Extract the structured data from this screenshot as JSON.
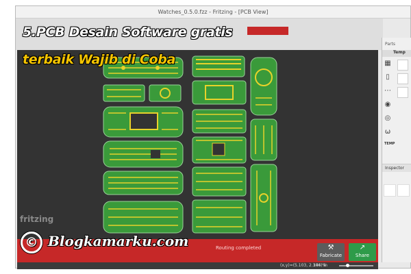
{
  "window": {
    "title": "Watches_0.5.0.fzz - Fritzing - [PCB View]"
  },
  "overlay": {
    "line1": "5.PCB Desain Software gratis",
    "line2": "terbaik Wajib di Coba"
  },
  "canvas": {
    "brand_mark": "fritzing"
  },
  "bottom_bar": {
    "status": "Routing completed",
    "fabricate_label": "Fabricate",
    "share_label": "Share"
  },
  "status_bar": {
    "coords": "(x,y)=(5.103, 2.306) in",
    "zoom": "144 %"
  },
  "right_panel": {
    "parts_title": "Parts",
    "parts_tab": "Temp",
    "temp_label": "TEMP",
    "inspector_title": "Inspector"
  },
  "watermark": {
    "text": "Blogkamarku.com"
  },
  "colors": {
    "pcb_green": "#3a9a3a",
    "trace_yellow": "#e8d22a",
    "canvas_bg": "#333333",
    "accent_red": "#c62828",
    "share_green": "#2e9b49"
  }
}
